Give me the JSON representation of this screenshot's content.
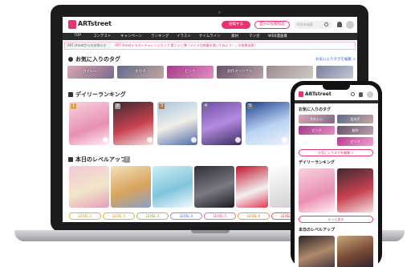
{
  "brand": {
    "name": "ARTstreet",
    "accent": "#e8336d",
    "dark": "#2b2b2e"
  },
  "header": {
    "post_button": "投稿する",
    "my_works_button": "自分の投稿作品",
    "search_placeholder": "作品を検索"
  },
  "nav": {
    "items": [
      "TOP",
      "コンテスト",
      "キャンペーン",
      "ランキング",
      "イラスト",
      "ケイムライン",
      "素材",
      "マンガ",
      "WEB漫画賞"
    ]
  },
  "banner": {
    "tag": "ART streetからのお知らせ",
    "text": "ART streetイラストチャレンジカップ 第二十三弾「メイドな執事を描いてみよう！」の結果発表！"
  },
  "favorites": {
    "title": "お気に入りのタグ",
    "edit_link": "お気に入りタグを編集 >",
    "tags": [
      "かわいい",
      "女の子",
      "ピンク",
      "創作オリジナル",
      "",
      ""
    ]
  },
  "ranking": {
    "title": "デイリーランキング",
    "more_link": "もっと見る >",
    "ranks": [
      "1",
      "2",
      "3",
      "4",
      "5"
    ]
  },
  "levelup": {
    "title": "本日のレベルアップ",
    "badge": "?",
    "levels": [
      "LEVEL 2",
      "LEVEL 3",
      "LEVEL 3",
      "LEVEL 4",
      "LEVEL 5",
      "LEVEL 6",
      "LEVEL 7"
    ]
  },
  "phone": {
    "favorites_title": "お気に入りのタグ",
    "tags": [
      "かわいい",
      "女の子",
      "ピンク",
      "創作",
      "ピンク"
    ],
    "edit_button": "お気に入りタグを編集 >",
    "ranking_title": "デイリーランキング",
    "more_button": "もっと見る",
    "levelup_title": "本日のレベルアップ"
  }
}
